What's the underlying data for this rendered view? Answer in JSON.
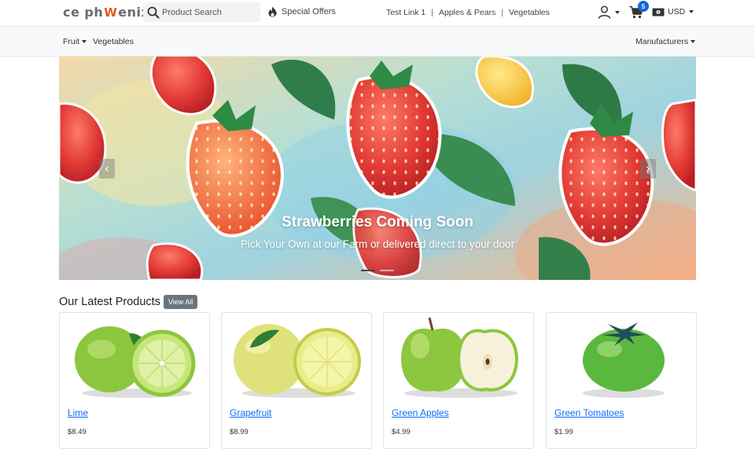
{
  "header": {
    "logo_left": "ce ph",
    "logo_right": "enix",
    "search": {
      "placeholder": "Product Search"
    },
    "special_offers_label": "Special Offers",
    "links": [
      "Test Link 1",
      "Apples & Pears",
      "Vegetables"
    ],
    "cart_count": "5",
    "currency": "USD"
  },
  "subnav": {
    "left": [
      {
        "label": "Fruit",
        "dropdown": true
      },
      {
        "label": "Vegetables",
        "dropdown": false
      }
    ],
    "right": {
      "label": "Manufacturers",
      "dropdown": true
    }
  },
  "hero": {
    "title": "Strawberries Coming Soon",
    "subtitle": "Pick Your Own at our Farm or delivered direct to your door",
    "prev_icon": "chevron-left-icon",
    "next_icon": "chevron-right-icon",
    "slides": 2,
    "active_slide": 0
  },
  "latest": {
    "title": "Our Latest Products",
    "view_all_label": "View All",
    "products": [
      {
        "name": "Lime",
        "price": "$8.49"
      },
      {
        "name": "Grapefruit",
        "price": "$8.99"
      },
      {
        "name": "Green Apples",
        "price": "$4.99"
      },
      {
        "name": "Green Tomatoes",
        "price": "$1.99"
      }
    ]
  },
  "colors": {
    "link": "#0d6efd",
    "badge": "#1468d6",
    "view_all_bg": "#6c757d",
    "logo_flame": "#e8541c"
  }
}
